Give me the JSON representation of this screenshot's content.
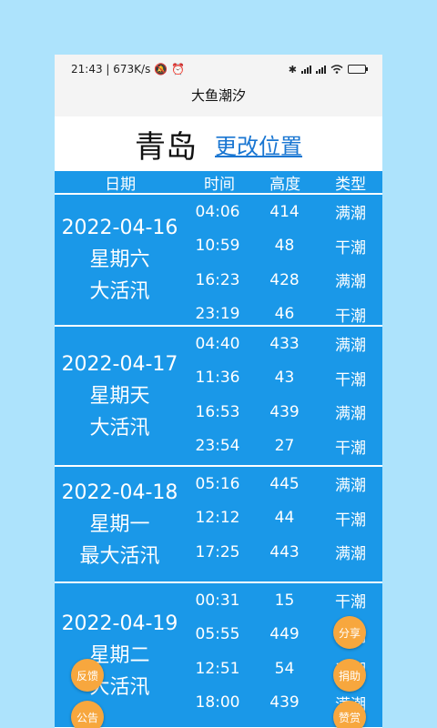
{
  "status": {
    "time": "21:43",
    "speed": "673K/s",
    "battery_color": "#3cb24a"
  },
  "app_title": "大鱼潮汐",
  "city": "青岛",
  "change_location": "更改位置",
  "headers": {
    "date": "日期",
    "time": "时间",
    "height": "高度",
    "type": "类型"
  },
  "days": [
    {
      "date": "2022-04-16",
      "weekday": "星期六",
      "tide_name": "大活汛",
      "rows": [
        {
          "time": "04:06",
          "height": "414",
          "type": "满潮"
        },
        {
          "time": "10:59",
          "height": "48",
          "type": "干潮"
        },
        {
          "time": "16:23",
          "height": "428",
          "type": "满潮"
        },
        {
          "time": "23:19",
          "height": "46",
          "type": "干潮"
        }
      ]
    },
    {
      "date": "2022-04-17",
      "weekday": "星期天",
      "tide_name": "大活汛",
      "rows": [
        {
          "time": "04:40",
          "height": "433",
          "type": "满潮"
        },
        {
          "time": "11:36",
          "height": "43",
          "type": "干潮"
        },
        {
          "time": "16:53",
          "height": "439",
          "type": "满潮"
        },
        {
          "time": "23:54",
          "height": "27",
          "type": "干潮"
        }
      ]
    },
    {
      "date": "2022-04-18",
      "weekday": "星期一",
      "tide_name": "最大活汛",
      "rows": [
        {
          "time": "05:16",
          "height": "445",
          "type": "满潮"
        },
        {
          "time": "12:12",
          "height": "44",
          "type": "干潮"
        },
        {
          "time": "17:25",
          "height": "443",
          "type": "满潮"
        }
      ]
    },
    {
      "date": "2022-04-19",
      "weekday": "星期二",
      "tide_name": "大活汛",
      "rows": [
        {
          "time": "00:31",
          "height": "15",
          "type": "干潮"
        },
        {
          "time": "05:55",
          "height": "449",
          "type": "满潮"
        },
        {
          "time": "12:51",
          "height": "54",
          "type": "干潮"
        },
        {
          "time": "18:00",
          "height": "439",
          "type": "满潮"
        }
      ]
    }
  ],
  "fabs": {
    "share": "分享",
    "donate": "捐助",
    "reward": "赞赏",
    "feedback": "反馈",
    "notice": "公告"
  }
}
